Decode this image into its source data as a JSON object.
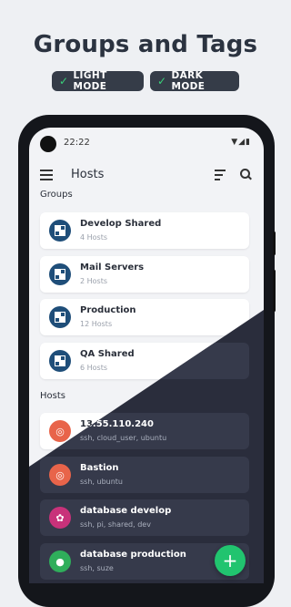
{
  "promo": {
    "headline": "Groups and Tags",
    "badges": [
      {
        "label": "LIGHT MODE"
      },
      {
        "label": "DARK MODE"
      }
    ]
  },
  "status_bar": {
    "time": "22:22"
  },
  "app_bar": {
    "title": "Hosts"
  },
  "groups": {
    "heading": "Groups",
    "items": [
      {
        "title": "Develop Shared",
        "subtitle": "4 Hosts"
      },
      {
        "title": "Mail Servers",
        "subtitle": "2 Hosts"
      },
      {
        "title": "Production",
        "subtitle": "12 Hosts"
      },
      {
        "title": "QA Shared",
        "subtitle": "6 Hosts"
      }
    ]
  },
  "hosts": {
    "heading": "Hosts",
    "items": [
      {
        "title": "13.55.110.240",
        "subtitle": "ssh, cloud_user, ubuntu",
        "icon": "ubuntu-icon",
        "color": "#e8644a"
      },
      {
        "title": "Bastion",
        "subtitle": "ssh, ubuntu",
        "icon": "ubuntu-icon",
        "color": "#e8644a"
      },
      {
        "title": "database develop",
        "subtitle": "ssh, pi, shared, dev",
        "icon": "raspberry-pi-icon",
        "color": "#c8327a"
      },
      {
        "title": "database production",
        "subtitle": "ssh, suze",
        "icon": "suse-icon",
        "color": "#2fae5b"
      }
    ]
  },
  "fab": {
    "label": "+"
  },
  "colors": {
    "accent": "#21c46f",
    "group_avatar": "#1f4e79",
    "dark_bg": "#2a2d3c",
    "dark_card": "#363a4b"
  }
}
